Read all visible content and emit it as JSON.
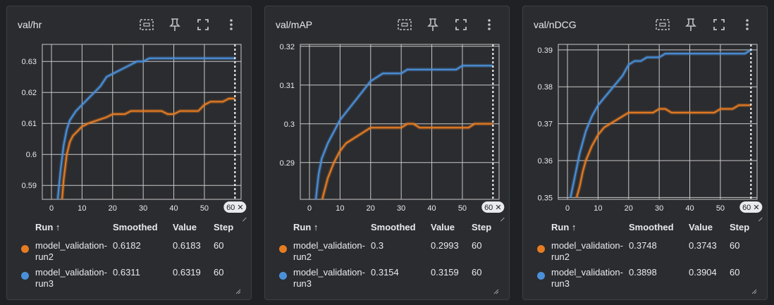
{
  "colors": {
    "run2": "#e67c22",
    "run3": "#4a90d9",
    "grid": "#c8c8c8",
    "axis_text": "#e8eaed"
  },
  "icons": [
    "fit-domain-icon",
    "pin-icon",
    "fullscreen-icon",
    "more-vert-icon"
  ],
  "table_headers": {
    "run": "Run ↑",
    "smoothed": "Smoothed",
    "value": "Value",
    "step": "Step"
  },
  "cards": [
    {
      "title": "val/hr",
      "step_badge": "60 ✕",
      "rows": [
        {
          "name_line1": "model_validation-",
          "name_line2": "run2",
          "smoothed": "0.6182",
          "value": "0.6183",
          "step": "60"
        },
        {
          "name_line1": "model_validation-",
          "name_line2": "run3",
          "smoothed": "0.6311",
          "value": "0.6319",
          "step": "60"
        }
      ]
    },
    {
      "title": "val/mAP",
      "step_badge": "60 ✕",
      "rows": [
        {
          "name_line1": "model_validation-",
          "name_line2": "run2",
          "smoothed": "0.3",
          "value": "0.2993",
          "step": "60"
        },
        {
          "name_line1": "model_validation-",
          "name_line2": "run3",
          "smoothed": "0.3154",
          "value": "0.3159",
          "step": "60"
        }
      ]
    },
    {
      "title": "val/nDCG",
      "step_badge": "60 ✕",
      "rows": [
        {
          "name_line1": "model_validation-",
          "name_line2": "run2",
          "smoothed": "0.3748",
          "value": "0.3743",
          "step": "60"
        },
        {
          "name_line1": "model_validation-",
          "name_line2": "run3",
          "smoothed": "0.3898",
          "value": "0.3904",
          "step": "60"
        }
      ]
    }
  ],
  "chart_data": [
    {
      "type": "line",
      "title": "val/hr",
      "xlabel": "",
      "ylabel": "",
      "xlim": [
        -3,
        62
      ],
      "ylim": [
        0.5855,
        0.6355
      ],
      "xticks": [
        0,
        10,
        20,
        30,
        40,
        50
      ],
      "yticks": [
        0.59,
        0.6,
        0.61,
        0.62,
        0.63
      ],
      "ytick_labels": [
        "0.59",
        "0.6",
        "0.61",
        "0.62",
        "0.63"
      ],
      "grid": true,
      "series": [
        {
          "name": "model_validation-run2",
          "color": "#e67c22",
          "x": [
            3,
            4,
            5,
            6,
            7,
            8,
            10,
            12,
            15,
            18,
            20,
            22,
            24,
            26,
            28,
            30,
            32,
            34,
            36,
            38,
            40,
            42,
            44,
            46,
            48,
            50,
            52,
            54,
            56,
            58,
            60
          ],
          "y": [
            0.58,
            0.592,
            0.6,
            0.604,
            0.606,
            0.607,
            0.609,
            0.61,
            0.611,
            0.612,
            0.613,
            0.613,
            0.613,
            0.614,
            0.614,
            0.614,
            0.614,
            0.614,
            0.614,
            0.613,
            0.613,
            0.614,
            0.614,
            0.614,
            0.614,
            0.616,
            0.617,
            0.617,
            0.617,
            0.618,
            0.618
          ]
        },
        {
          "name": "model_validation-run3",
          "color": "#4a90d9",
          "x": [
            2,
            3,
            4,
            5,
            6,
            8,
            10,
            12,
            14,
            16,
            18,
            20,
            22,
            24,
            26,
            28,
            30,
            32,
            34,
            36,
            38,
            40,
            42,
            44,
            46,
            48,
            50,
            52,
            54,
            56,
            58,
            60
          ],
          "y": [
            0.585,
            0.595,
            0.603,
            0.608,
            0.611,
            0.614,
            0.616,
            0.618,
            0.62,
            0.622,
            0.625,
            0.626,
            0.627,
            0.628,
            0.629,
            0.63,
            0.63,
            0.631,
            0.631,
            0.631,
            0.631,
            0.631,
            0.631,
            0.631,
            0.631,
            0.631,
            0.631,
            0.631,
            0.631,
            0.631,
            0.631,
            0.631
          ]
        }
      ]
    },
    {
      "type": "line",
      "title": "val/mAP",
      "xlabel": "",
      "ylabel": "",
      "xlim": [
        -3,
        62
      ],
      "ylim": [
        0.2805,
        0.3205
      ],
      "xticks": [
        0,
        10,
        20,
        30,
        40,
        50
      ],
      "yticks": [
        0.29,
        0.3,
        0.31,
        0.32
      ],
      "ytick_labels": [
        "0.29",
        "0.3",
        "0.31",
        "0.32"
      ],
      "grid": true,
      "series": [
        {
          "name": "model_validation-run2",
          "color": "#e67c22",
          "x": [
            4,
            5,
            6,
            7,
            8,
            10,
            12,
            14,
            16,
            18,
            20,
            22,
            24,
            26,
            28,
            30,
            32,
            34,
            36,
            38,
            40,
            42,
            44,
            46,
            48,
            50,
            52,
            54,
            56,
            58,
            60
          ],
          "y": [
            0.28,
            0.283,
            0.286,
            0.288,
            0.29,
            0.293,
            0.295,
            0.296,
            0.297,
            0.298,
            0.299,
            0.299,
            0.299,
            0.299,
            0.299,
            0.299,
            0.3,
            0.3,
            0.299,
            0.299,
            0.299,
            0.299,
            0.299,
            0.299,
            0.299,
            0.299,
            0.299,
            0.3,
            0.3,
            0.3,
            0.3
          ]
        },
        {
          "name": "model_validation-run3",
          "color": "#4a90d9",
          "x": [
            2,
            3,
            4,
            5,
            6,
            8,
            10,
            12,
            14,
            16,
            18,
            20,
            22,
            24,
            26,
            28,
            30,
            32,
            34,
            36,
            38,
            40,
            42,
            44,
            46,
            48,
            50,
            52,
            54,
            56,
            58,
            60
          ],
          "y": [
            0.28,
            0.287,
            0.291,
            0.293,
            0.295,
            0.298,
            0.301,
            0.303,
            0.305,
            0.307,
            0.309,
            0.311,
            0.312,
            0.313,
            0.313,
            0.313,
            0.313,
            0.314,
            0.314,
            0.314,
            0.314,
            0.314,
            0.314,
            0.314,
            0.314,
            0.314,
            0.315,
            0.315,
            0.315,
            0.315,
            0.315,
            0.315
          ]
        }
      ]
    },
    {
      "type": "line",
      "title": "val/nDCG",
      "xlabel": "",
      "ylabel": "",
      "xlim": [
        -3,
        62
      ],
      "ylim": [
        0.3495,
        0.3915
      ],
      "xticks": [
        0,
        10,
        20,
        30,
        40,
        50
      ],
      "yticks": [
        0.35,
        0.36,
        0.37,
        0.38,
        0.39
      ],
      "ytick_labels": [
        "0.35",
        "0.36",
        "0.37",
        "0.38",
        "0.39"
      ],
      "grid": true,
      "series": [
        {
          "name": "model_validation-run2",
          "color": "#e67c22",
          "x": [
            3,
            4,
            5,
            6,
            7,
            8,
            10,
            12,
            14,
            16,
            18,
            20,
            22,
            24,
            26,
            28,
            30,
            32,
            34,
            36,
            38,
            40,
            42,
            44,
            46,
            48,
            50,
            52,
            54,
            56,
            58,
            60
          ],
          "y": [
            0.35,
            0.353,
            0.357,
            0.36,
            0.362,
            0.364,
            0.367,
            0.369,
            0.37,
            0.371,
            0.372,
            0.373,
            0.373,
            0.373,
            0.373,
            0.373,
            0.374,
            0.374,
            0.373,
            0.373,
            0.373,
            0.373,
            0.373,
            0.373,
            0.373,
            0.373,
            0.374,
            0.374,
            0.374,
            0.375,
            0.375,
            0.375
          ]
        },
        {
          "name": "model_validation-run3",
          "color": "#4a90d9",
          "x": [
            1,
            2,
            3,
            4,
            5,
            6,
            8,
            10,
            12,
            14,
            16,
            18,
            20,
            22,
            24,
            26,
            28,
            30,
            32,
            34,
            36,
            38,
            40,
            42,
            44,
            46,
            48,
            50,
            52,
            54,
            56,
            58,
            60
          ],
          "y": [
            0.35,
            0.354,
            0.358,
            0.362,
            0.365,
            0.368,
            0.372,
            0.375,
            0.377,
            0.379,
            0.381,
            0.383,
            0.386,
            0.387,
            0.387,
            0.388,
            0.388,
            0.388,
            0.389,
            0.389,
            0.389,
            0.389,
            0.389,
            0.389,
            0.389,
            0.389,
            0.389,
            0.389,
            0.389,
            0.389,
            0.389,
            0.389,
            0.39
          ]
        }
      ]
    }
  ]
}
